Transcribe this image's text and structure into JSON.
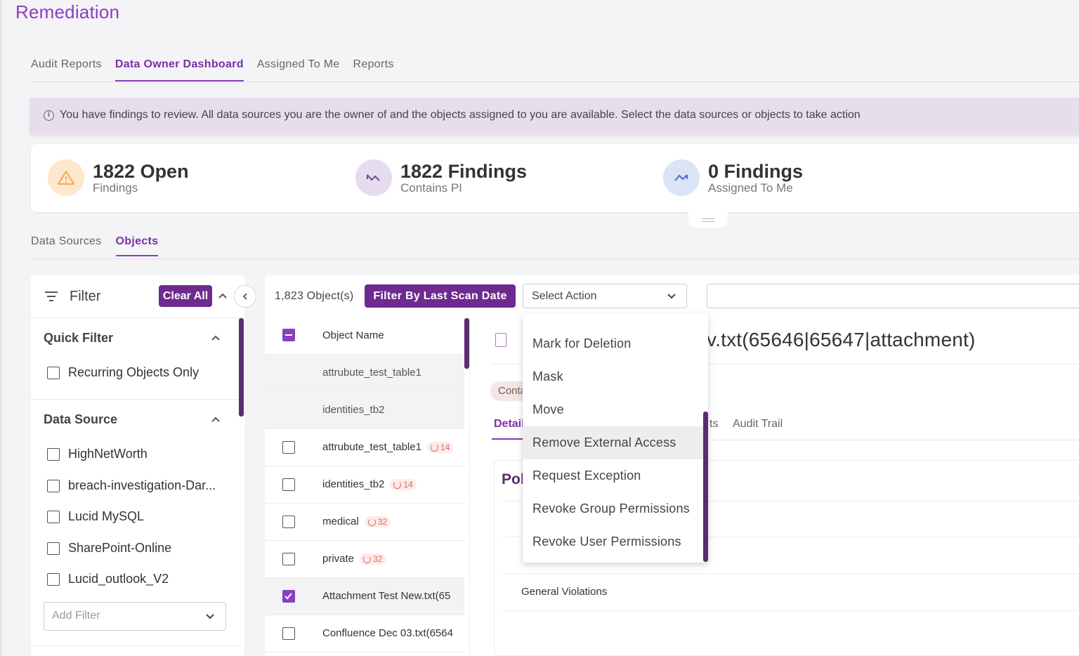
{
  "app": {
    "title": "Remediation"
  },
  "tabs": [
    {
      "label": "Audit Reports",
      "active": false
    },
    {
      "label": "Data Owner Dashboard",
      "active": true
    },
    {
      "label": "Assigned To Me",
      "active": false
    },
    {
      "label": "Reports",
      "active": false
    }
  ],
  "banner": {
    "icon": "info-icon",
    "text": "You have findings to review. All data sources you are the owner of and the objects assigned to you are available. Select the data sources or objects to take action"
  },
  "kpis": [
    {
      "icon": "warning-icon",
      "value": "1822 Open",
      "label": "Findings",
      "color": "#f3a94f",
      "bg": "#fde7cf"
    },
    {
      "icon": "trend-down-icon",
      "value": "1822 Findings",
      "label": "Contains PI",
      "color": "#8a5fa6",
      "bg": "#e6dcef"
    },
    {
      "icon": "trend-up-icon",
      "value": "0 Findings",
      "label": "Assigned To Me",
      "color": "#4a6cc8",
      "bg": "#dbe3f7"
    }
  ],
  "subtabs": [
    {
      "label": "Data Sources",
      "active": false
    },
    {
      "label": "Objects",
      "active": true
    }
  ],
  "filter": {
    "title": "Filter",
    "clear_all": "Clear All",
    "quick_filter": {
      "title": "Quick Filter",
      "options": [
        "Recurring Objects Only"
      ]
    },
    "data_source": {
      "title": "Data Source",
      "options": [
        "HighNetWorth",
        "breach-investigation-Dar...",
        "Lucid MySQL",
        "SharePoint-Online",
        "Lucid_outlook_V2"
      ]
    },
    "add_filter_placeholder": "Add Filter"
  },
  "toolbar": {
    "object_count": "1,823 Object(s)",
    "filter_by_date": "Filter By Last Scan Date",
    "select_action": "Select Action"
  },
  "list": {
    "header": "Object Name",
    "rows": [
      {
        "name": "attrubute_test_table1",
        "badge": "",
        "sub": true
      },
      {
        "name": "identities_tb2",
        "badge": "",
        "sub": true
      },
      {
        "name": "attrubute_test_table1",
        "badge": "14",
        "sub": false
      },
      {
        "name": "identities_tb2",
        "badge": "14",
        "sub": false
      },
      {
        "name": "medical",
        "badge": "32",
        "sub": false
      },
      {
        "name": "private",
        "badge": "32",
        "sub": false
      },
      {
        "name": "Attachment Test New.txt(65",
        "badge": "",
        "sub": false,
        "checked": true
      },
      {
        "name": "Confluence Dec 03.txt(6564",
        "badge": "",
        "sub": false
      }
    ]
  },
  "detail": {
    "title": "v.txt(65646|65647|attachment)",
    "chip": "Conta",
    "tab_active": "Detail",
    "tab_partial": "ts",
    "tab_audit": "Audit Trail",
    "policy_title": "Pol",
    "general_violations": "General Violations"
  },
  "dropdown": {
    "items": [
      "Mark for Deletion",
      "Mask",
      "Move",
      "Remove External Access",
      "Request Exception",
      "Revoke Group Permissions",
      "Revoke User Permissions"
    ],
    "hover_index": 3
  }
}
